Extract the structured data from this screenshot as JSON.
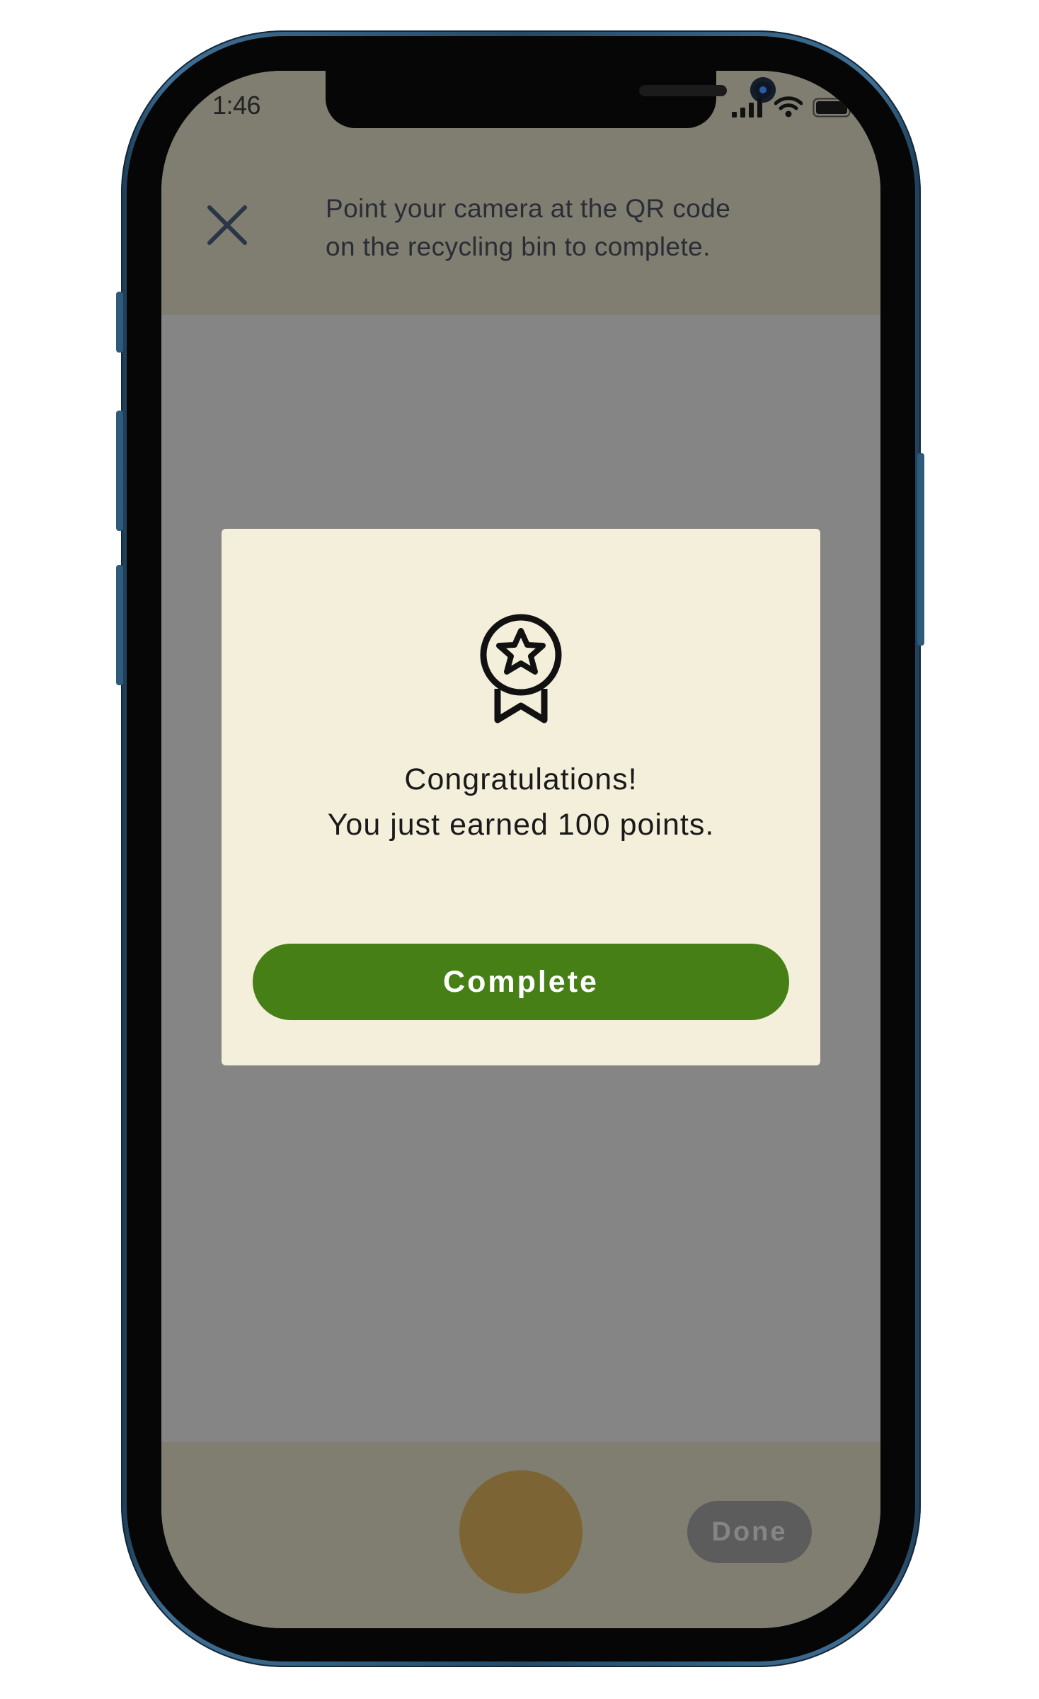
{
  "status_bar": {
    "time": "1:46"
  },
  "scanner": {
    "instruction_line1": "Point your camera at the QR code",
    "instruction_line2": "on the recycling bin to complete."
  },
  "modal": {
    "message_line1": "Congratulations!",
    "message_line2": "You just earned 100 points.",
    "complete_label": "Complete",
    "icon": "award-medal-icon"
  },
  "bottom_bar": {
    "done_label": "Done"
  },
  "colors": {
    "accent_green": "#467f16",
    "modal_background": "#f4efdb",
    "overlay_gray": "#858585",
    "bar_dimmed": "#807e70",
    "shutter_dimmed": "#7c6434"
  }
}
